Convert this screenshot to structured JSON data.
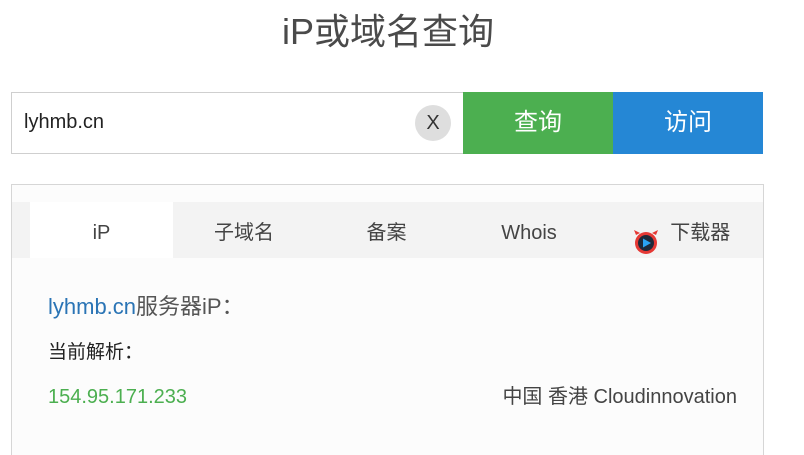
{
  "page": {
    "title": "iP或域名查询"
  },
  "search": {
    "value": "lyhmb.cn",
    "clear_label": "X",
    "query_label": "查询",
    "visit_label": "访问"
  },
  "tabs": [
    {
      "label": "iP",
      "active": true
    },
    {
      "label": "子域名",
      "active": false
    },
    {
      "label": "备案",
      "active": false
    },
    {
      "label": "Whois",
      "active": false
    },
    {
      "label": "下载器",
      "active": false,
      "icon": "downloader-play-icon"
    }
  ],
  "result": {
    "domain": "lyhmb.cn",
    "heading_suffix": "服务器iP：",
    "current_label": "当前解析：",
    "ip": "154.95.171.233",
    "location": "中国 香港 Cloudinnovation"
  },
  "colors": {
    "query_button": "#4caf50",
    "visit_button": "#2587d5",
    "ip_text": "#4caf50",
    "domain_link": "#2a74b5"
  }
}
